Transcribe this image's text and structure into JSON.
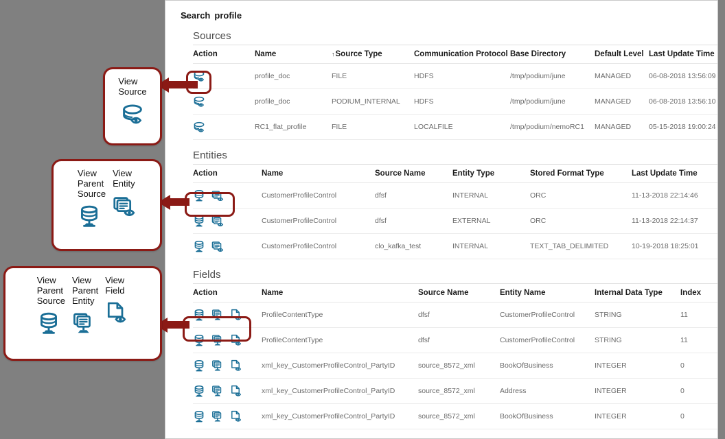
{
  "colors": {
    "accent_red": "#8B1A15",
    "icon_blue": "#1a6e96",
    "page_bg": "#808080",
    "panel_bg": "#ffffff"
  },
  "breadcrumb": {
    "root": "Search",
    "separator": "→",
    "current": "profile"
  },
  "sections": [
    {
      "key": "sources",
      "title": "Sources",
      "columns": [
        "Action",
        "Name",
        "Source Type",
        "Communication Protocol",
        "Base Directory",
        "Default Level",
        "Last Update Time"
      ],
      "sorted_column": "Source Type",
      "sort_direction": "asc",
      "action_icons": [
        "view-source-icon"
      ],
      "rows": [
        {
          "name": "profile_doc",
          "source_type": "FILE",
          "communication_protocol": "HDFS",
          "base_directory": "/tmp/podium/june",
          "default_level": "MANAGED",
          "last_update_time": "06-08-2018 13:56:09"
        },
        {
          "name": "profile_doc",
          "source_type": "PODIUM_INTERNAL",
          "communication_protocol": "HDFS",
          "base_directory": "/tmp/podium/june",
          "default_level": "MANAGED",
          "last_update_time": "06-08-2018 13:56:10"
        },
        {
          "name": "RC1_flat_profile",
          "source_type": "FILE",
          "communication_protocol": "LOCALFILE",
          "base_directory": "/tmp/podium/nemoRC1",
          "default_level": "MANAGED",
          "last_update_time": "05-15-2018 19:00:24"
        }
      ]
    },
    {
      "key": "entities",
      "title": "Entities",
      "columns": [
        "Action",
        "Name",
        "Source Name",
        "Entity Type",
        "Stored Format Type",
        "Last Update Time"
      ],
      "action_icons": [
        "view-parent-source-icon",
        "view-entity-icon"
      ],
      "rows": [
        {
          "name": "CustomerProfileControl",
          "source_name": "dfsf",
          "entity_type": "INTERNAL",
          "stored_format_type": "ORC",
          "last_update_time": "11-13-2018 22:14:46"
        },
        {
          "name": "CustomerProfileControl",
          "source_name": "dfsf",
          "entity_type": "EXTERNAL",
          "stored_format_type": "ORC",
          "last_update_time": "11-13-2018 22:14:37"
        },
        {
          "name": "CustomerProfileControl",
          "source_name": "clo_kafka_test",
          "entity_type": "INTERNAL",
          "stored_format_type": "TEXT_TAB_DELIMITED",
          "last_update_time": "10-19-2018 18:25:01"
        }
      ]
    },
    {
      "key": "fields",
      "title": "Fields",
      "columns": [
        "Action",
        "Name",
        "Source Name",
        "Entity Name",
        "Internal Data Type",
        "Index"
      ],
      "action_icons": [
        "view-parent-source-icon",
        "view-parent-entity-icon",
        "view-field-icon"
      ],
      "rows": [
        {
          "name": "ProfileContentType",
          "source_name": "dfsf",
          "entity_name": "CustomerProfileControl",
          "internal_data_type": "STRING",
          "index": "11"
        },
        {
          "name": "ProfileContentType",
          "source_name": "dfsf",
          "entity_name": "CustomerProfileControl",
          "internal_data_type": "STRING",
          "index": "11"
        },
        {
          "name": "xml_key_CustomerProfileControl_PartyID",
          "source_name": "source_8572_xml",
          "entity_name": "BookOfBusiness",
          "internal_data_type": "INTEGER",
          "index": "0"
        },
        {
          "name": "xml_key_CustomerProfileControl_PartyID",
          "source_name": "source_8572_xml",
          "entity_name": "Address",
          "internal_data_type": "INTEGER",
          "index": "0"
        },
        {
          "name": "xml_key_CustomerProfileControl_PartyID",
          "source_name": "source_8572_xml",
          "entity_name": "BookOfBusiness",
          "internal_data_type": "INTEGER",
          "index": "0"
        }
      ]
    }
  ],
  "callouts": [
    {
      "key": "source",
      "items": [
        {
          "label": "View\nSource",
          "icon": "view-source-icon"
        }
      ]
    },
    {
      "key": "entity",
      "items": [
        {
          "label": "View\nParent\nSource",
          "icon": "view-parent-source-icon"
        },
        {
          "label": "View\nEntity",
          "icon": "view-entity-icon"
        }
      ]
    },
    {
      "key": "field",
      "items": [
        {
          "label": "View\nParent\nSource",
          "icon": "view-parent-source-icon"
        },
        {
          "label": "View\nParent\nEntity",
          "icon": "view-parent-entity-icon"
        },
        {
          "label": "View\nField",
          "icon": "view-field-icon"
        }
      ]
    }
  ]
}
